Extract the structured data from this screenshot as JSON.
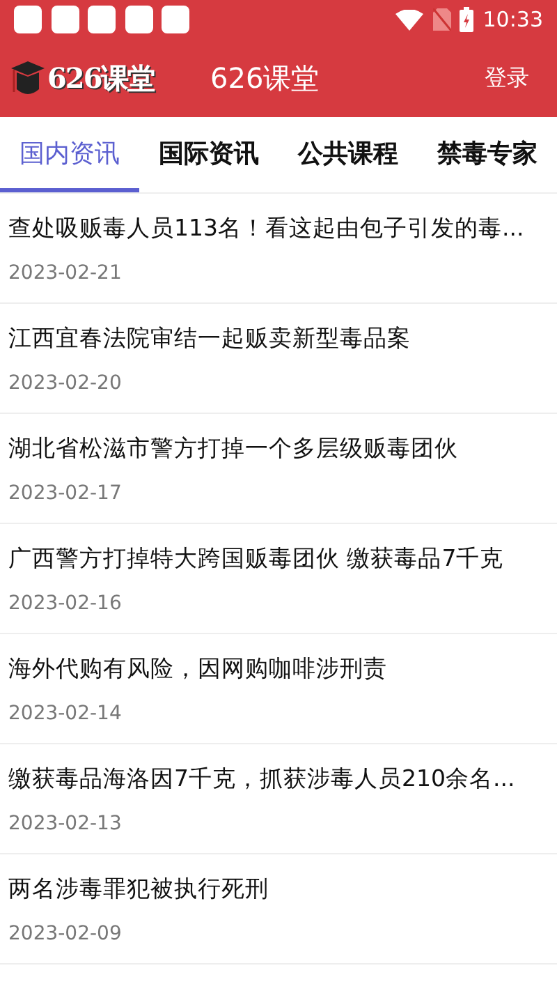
{
  "status_bar": {
    "time": "10:33"
  },
  "header": {
    "logo_text": "626课堂",
    "title": "626课堂",
    "login": "登录"
  },
  "tabs": [
    {
      "label": "国内资讯",
      "selected": true
    },
    {
      "label": "国际资讯",
      "selected": false
    },
    {
      "label": "公共课程",
      "selected": false
    },
    {
      "label": "禁毒专家",
      "selected": false
    }
  ],
  "articles": [
    {
      "title": "查处吸贩毒人员113名！看这起由包子引发的毒...",
      "date": "2023-02-21"
    },
    {
      "title": "江西宜春法院审结一起贩卖新型毒品案",
      "date": "2023-02-20"
    },
    {
      "title": "湖北省松滋市警方打掉一个多层级贩毒团伙",
      "date": "2023-02-17"
    },
    {
      "title": "广西警方打掉特大跨国贩毒团伙 缴获毒品7千克",
      "date": "2023-02-16"
    },
    {
      "title": "海外代购有风险，因网购咖啡涉刑责",
      "date": "2023-02-14"
    },
    {
      "title": "缴获毒品海洛因7千克，抓获涉毒人员210余名...",
      "date": "2023-02-13"
    },
    {
      "title": "两名涉毒罪犯被执行死刑",
      "date": "2023-02-09"
    }
  ]
}
